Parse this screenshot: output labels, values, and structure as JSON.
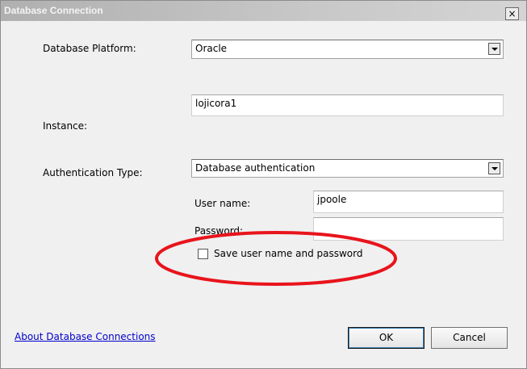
{
  "window": {
    "title": "Database Connection",
    "close_label": "×"
  },
  "form": {
    "platform_label": "Database Platform:",
    "platform_value": "Oracle",
    "instance_label": "Instance:",
    "instance_value": "lojicora1",
    "auth_label": "Authentication Type:",
    "auth_value": "Database authentication",
    "username_label": "User name:",
    "username_value": "jpoole",
    "password_label": "Password:",
    "password_value": "",
    "save_checkbox_label": "Save user name and password",
    "save_checked": false
  },
  "footer": {
    "help_link": "About Database Connections",
    "ok_label": "OK",
    "cancel_label": "Cancel"
  },
  "annotation": {
    "highlight_color": "#e8141c"
  }
}
